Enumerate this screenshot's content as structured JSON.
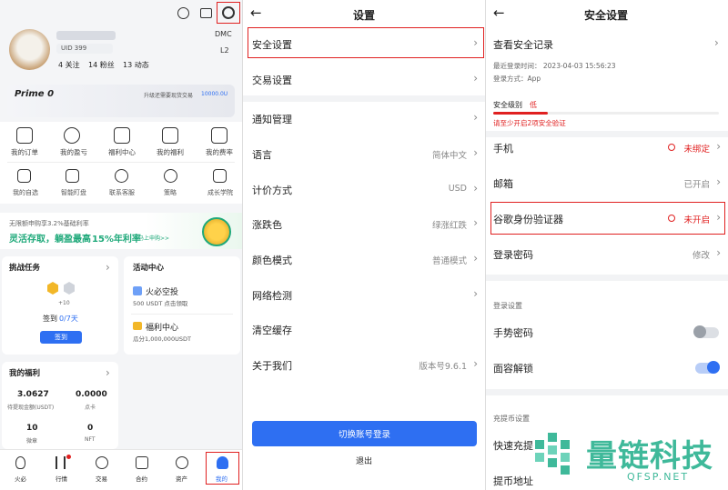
{
  "p1": {
    "uid": "UID 399",
    "badge_dmc": "DMC",
    "badge_l2": "L2",
    "stats": [
      "4 关注",
      "14 粉丝",
      "13 动态"
    ],
    "prime_title": "Prime 0",
    "prime_upgrade": "升级还需要现货交易",
    "prime_amount": "10000.0U",
    "menu_row1": [
      "我的订单",
      "我的盈亏",
      "福利中心",
      "我的福利",
      "我的费率"
    ],
    "menu_row2": [
      "我的自选",
      "智能盯盘",
      "联系客服",
      "策略",
      "成长学院"
    ],
    "banner_small": "无限额申购享3.2%基础利率",
    "banner_main_a": "灵活存取，躺盈最高",
    "banner_main_b": "15%年利率",
    "banner_link": "马上申购>>",
    "challenge_title": "挑战任务",
    "challenge_plus": "+10",
    "challenge_signin": "签到",
    "challenge_progress": "0/7天",
    "challenge_button": "签到",
    "activity_title": "活动中心",
    "act1_title": "火必空投",
    "act1_sub": "500 USDT 点击领取",
    "act2_title": "福利中心",
    "act2_sub": "瓜分1,000,000USDT",
    "welfare_title": "我的福利",
    "w1_val": "3.0627",
    "w1_lbl": "待提现金额(USDT)",
    "w2_val": "0.0000",
    "w2_lbl": "点卡",
    "w3_val": "10",
    "w3_lbl": "微章",
    "w4_val": "0",
    "w4_lbl": "NFT",
    "nav": [
      "火必",
      "行情",
      "交易",
      "合约",
      "资产",
      "我的"
    ]
  },
  "p2": {
    "title": "设置",
    "rows": [
      {
        "label": "安全设置",
        "value": ""
      },
      {
        "label": "交易设置",
        "value": ""
      },
      {
        "label": "通知管理",
        "value": ""
      },
      {
        "label": "语言",
        "value": "简体中文"
      },
      {
        "label": "计价方式",
        "value": "USD"
      },
      {
        "label": "涨跌色",
        "value": "绿涨红跌"
      },
      {
        "label": "颜色模式",
        "value": "普通模式"
      },
      {
        "label": "网络检测",
        "value": ""
      },
      {
        "label": "清空缓存",
        "value": ""
      },
      {
        "label": "关于我们",
        "value": "版本号9.6.1"
      }
    ],
    "switch_button": "切换账号登录",
    "logout": "退出"
  },
  "p3": {
    "title": "安全设置",
    "record_title": "查看安全记录",
    "last_login": "最近登录时间： 2023-04-03 15:56:23",
    "login_method": "登录方式：App",
    "level_label": "安全级别",
    "level_value": "低",
    "level_hint": "请至少开启2项安全验证",
    "rows": [
      {
        "label": "手机",
        "value": "未绑定",
        "warn": true
      },
      {
        "label": "邮箱",
        "value": "已开启",
        "warn": false
      },
      {
        "label": "谷歌身份验证器",
        "value": "未开启",
        "warn": true
      },
      {
        "label": "登录密码",
        "value": "修改",
        "warn": false
      }
    ],
    "section_login": "登录设置",
    "gesture": "手势密码",
    "face": "面容解锁",
    "section_deposit": "充提币设置",
    "quick": "快速充提",
    "address": "提币地址",
    "watermark_cn": "量链科技",
    "watermark_en": "QFSP.NET"
  },
  "colors": {
    "accent": "#2e6ff2",
    "red": "#e02020",
    "green": "#1fa97a"
  }
}
